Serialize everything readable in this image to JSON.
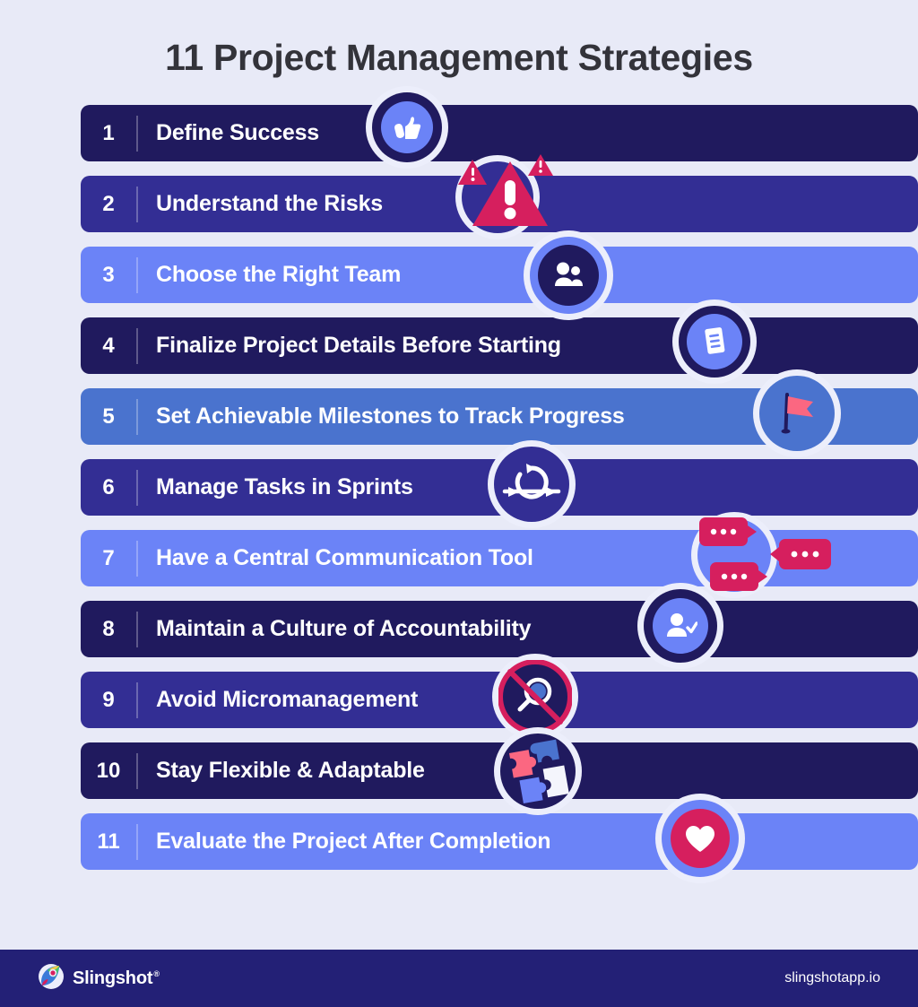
{
  "page": {
    "title": "11 Project Management Strategies",
    "background_color": "#e8eaf7"
  },
  "colors": {
    "deep_navy": "#201a5e",
    "indigo": "#332e94",
    "light_blue": "#6b83f7",
    "mid_blue": "#4a73ce",
    "crimson": "#d61f5e",
    "coral": "#fb6781",
    "white": "#ffffff",
    "footer_navy": "#232076",
    "title_text": "#33333a"
  },
  "strategies": [
    {
      "number": "1",
      "label": "Define Success",
      "bar_color": "deep_navy",
      "icon": "thumbs-up-icon"
    },
    {
      "number": "2",
      "label": "Understand the Risks",
      "bar_color": "indigo",
      "icon": "warning-triangle-icon"
    },
    {
      "number": "3",
      "label": "Choose the Right Team",
      "bar_color": "light_blue",
      "icon": "team-people-icon"
    },
    {
      "number": "4",
      "label": "Finalize Project Details Before Starting",
      "bar_color": "deep_navy",
      "icon": "document-icon"
    },
    {
      "number": "5",
      "label": "Set Achievable Milestones to Track Progress",
      "bar_color": "mid_blue",
      "icon": "flag-icon"
    },
    {
      "number": "6",
      "label": "Manage Tasks in Sprints",
      "bar_color": "indigo",
      "icon": "sprint-cycle-icon"
    },
    {
      "number": "7",
      "label": "Have a Central Communication Tool",
      "bar_color": "light_blue",
      "icon": "chat-bubbles-icon"
    },
    {
      "number": "8",
      "label": "Maintain a Culture of Accountability",
      "bar_color": "deep_navy",
      "icon": "person-check-icon"
    },
    {
      "number": "9",
      "label": "Avoid Micromanagement",
      "bar_color": "indigo",
      "icon": "no-magnifier-icon"
    },
    {
      "number": "10",
      "label": "Stay Flexible & Adaptable",
      "bar_color": "deep_navy",
      "icon": "puzzle-pieces-icon"
    },
    {
      "number": "11",
      "label": "Evaluate the Project After Completion",
      "bar_color": "light_blue",
      "icon": "heart-icon"
    }
  ],
  "footer": {
    "brand_name": "Slingshot",
    "trademark": "®",
    "logo_icon": "slingshot-rocket-logo",
    "website": "slingshotapp.io"
  }
}
